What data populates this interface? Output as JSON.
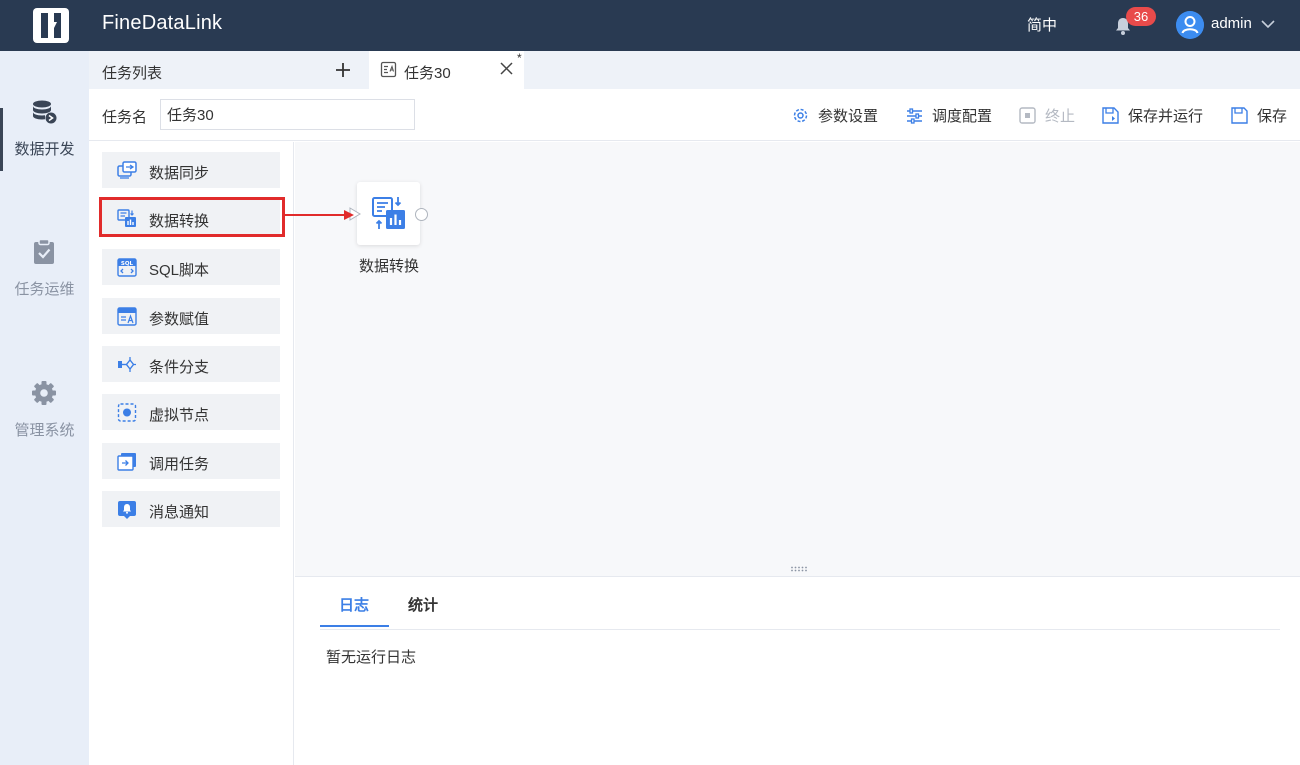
{
  "app": {
    "title": "FineDataLink"
  },
  "header": {
    "language": "简中",
    "notification_count": "36",
    "user": "admin"
  },
  "nav": {
    "items": [
      {
        "label": "数据开发",
        "icon": "database-icon",
        "active": true
      },
      {
        "label": "任务运维",
        "icon": "clipboard-check-icon",
        "active": false
      },
      {
        "label": "管理系统",
        "icon": "gear-icon",
        "active": false
      }
    ]
  },
  "tabs": {
    "list_label": "任务列表",
    "open_tab": {
      "label": "任务30",
      "dirty_marker": "*"
    }
  },
  "toolbar": {
    "task_name_label": "任务名",
    "task_name_value": "任务30",
    "param_settings": "参数设置",
    "schedule_config": "调度配置",
    "stop": "终止",
    "save_and_run": "保存并运行",
    "save": "保存"
  },
  "components": [
    {
      "label": "数据同步",
      "icon": "data-sync-icon"
    },
    {
      "label": "数据转换",
      "icon": "data-transform-icon"
    },
    {
      "label": "SQL脚本",
      "icon": "sql-script-icon"
    },
    {
      "label": "参数赋值",
      "icon": "param-assign-icon"
    },
    {
      "label": "条件分支",
      "icon": "condition-branch-icon"
    },
    {
      "label": "虚拟节点",
      "icon": "virtual-node-icon"
    },
    {
      "label": "调用任务",
      "icon": "call-task-icon"
    },
    {
      "label": "消息通知",
      "icon": "message-notify-icon"
    }
  ],
  "canvas": {
    "node_label": "数据转换"
  },
  "log": {
    "tabs": [
      {
        "label": "日志",
        "active": true
      },
      {
        "label": "统计",
        "active": false
      }
    ],
    "empty_text": "暂无运行日志"
  },
  "colors": {
    "header_bg": "#293a52",
    "accent": "#3c7fe6",
    "highlight": "#e12b2b",
    "badge": "#e84b4b"
  }
}
